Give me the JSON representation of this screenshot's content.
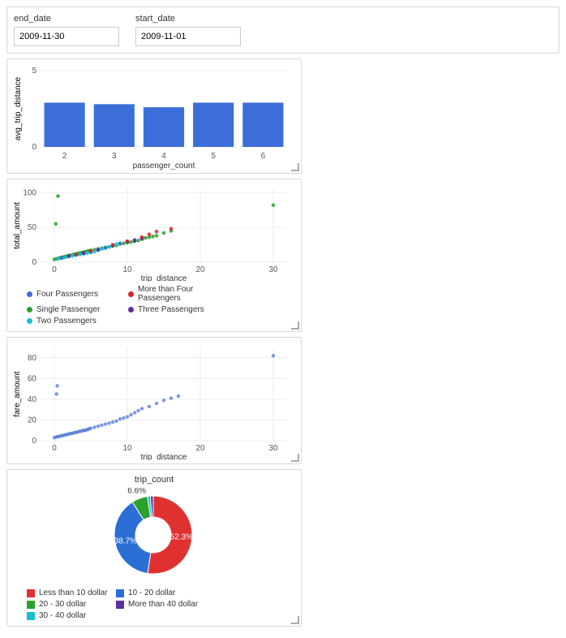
{
  "filters": {
    "end_date": {
      "label": "end_date",
      "value": "2009-11-30"
    },
    "start_date": {
      "label": "start_date",
      "value": "2009-11-01"
    }
  },
  "colors": {
    "bar": "#3b6ed8",
    "four": "#3b6ed8",
    "more_than_four": "#d62728",
    "single": "#2ca02c",
    "three": "#5b2f9e",
    "two": "#17becf",
    "scatter_single": "#5b7fd6",
    "pie_lt10": "#e03131",
    "pie_10_20": "#2b6fd6",
    "pie_20_30": "#2ca02c",
    "pie_gt40": "#5b2f9e",
    "pie_30_40": "#17becf"
  },
  "chart_data": [
    {
      "id": "bar",
      "type": "bar",
      "xlabel": "passenger_count",
      "ylabel": "avg_trip_distance",
      "x_ticks": [
        2,
        3,
        4,
        5,
        6
      ],
      "y_ticks": [
        0,
        5
      ],
      "ylim": [
        0,
        5
      ],
      "categories": [
        2,
        3,
        4,
        5,
        6
      ],
      "values": [
        2.9,
        2.8,
        2.6,
        2.9,
        2.9
      ]
    },
    {
      "id": "scatter_multi",
      "type": "scatter",
      "xlabel": "trip_distance",
      "ylabel": "total_amount",
      "x_ticks": [
        0,
        10,
        20,
        30
      ],
      "y_ticks": [
        0,
        50,
        100
      ],
      "xlim": [
        -2,
        32
      ],
      "ylim": [
        0,
        105
      ],
      "legend": [
        {
          "key": "four",
          "label": "Four Passengers"
        },
        {
          "key": "more_than_four",
          "label": "More than Four Passengers"
        },
        {
          "key": "single",
          "label": "Single Passenger"
        },
        {
          "key": "three",
          "label": "Three Passengers"
        },
        {
          "key": "two",
          "label": "Two Passengers"
        }
      ],
      "series": [
        {
          "name": "single",
          "points": [
            [
              0,
              4
            ],
            [
              0.3,
              5
            ],
            [
              0.5,
              5
            ],
            [
              0.7,
              6
            ],
            [
              0.9,
              6
            ],
            [
              1,
              7
            ],
            [
              1.2,
              7
            ],
            [
              1.4,
              8
            ],
            [
              1.6,
              8
            ],
            [
              1.8,
              9
            ],
            [
              2,
              9
            ],
            [
              2.2,
              10
            ],
            [
              2.4,
              10
            ],
            [
              2.6,
              11
            ],
            [
              2.8,
              11
            ],
            [
              3,
              12
            ],
            [
              3.2,
              12
            ],
            [
              3.4,
              13
            ],
            [
              3.6,
              13
            ],
            [
              3.8,
              14
            ],
            [
              4,
              14
            ],
            [
              4.2,
              15
            ],
            [
              4.4,
              15
            ],
            [
              4.6,
              16
            ],
            [
              4.8,
              16
            ],
            [
              5,
              17
            ],
            [
              5.5,
              18
            ],
            [
              6,
              19
            ],
            [
              6.5,
              20
            ],
            [
              7,
              21
            ],
            [
              7.5,
              22
            ],
            [
              8,
              23
            ],
            [
              8.5,
              24
            ],
            [
              9,
              26
            ],
            [
              9.5,
              27
            ],
            [
              10,
              28
            ],
            [
              10.5,
              29
            ],
            [
              11,
              30
            ],
            [
              11.5,
              31
            ],
            [
              12,
              33
            ],
            [
              12.5,
              35
            ],
            [
              13,
              36
            ],
            [
              13.5,
              37
            ],
            [
              14,
              38
            ],
            [
              15,
              42
            ],
            [
              16,
              45
            ],
            [
              0.2,
              55
            ],
            [
              0.5,
              95
            ],
            [
              30,
              82
            ]
          ]
        },
        {
          "name": "two",
          "points": [
            [
              0.5,
              5
            ],
            [
              1,
              6
            ],
            [
              1.5,
              7
            ],
            [
              2,
              8
            ],
            [
              2.5,
              9
            ],
            [
              3,
              10
            ],
            [
              3.5,
              11
            ],
            [
              4,
              12
            ],
            [
              4.5,
              13
            ],
            [
              5,
              14
            ],
            [
              5.5,
              15
            ],
            [
              6,
              17
            ],
            [
              6.5,
              19
            ],
            [
              7,
              20
            ],
            [
              7.5,
              22
            ],
            [
              8,
              24
            ],
            [
              8.5,
              26
            ],
            [
              9,
              27
            ],
            [
              10,
              29
            ]
          ]
        },
        {
          "name": "four",
          "points": [
            [
              1,
              6
            ],
            [
              2,
              9
            ],
            [
              3,
              11
            ],
            [
              4,
              13
            ],
            [
              5,
              15
            ],
            [
              6,
              18
            ],
            [
              7,
              21
            ],
            [
              8,
              24
            ],
            [
              9,
              27
            ],
            [
              10,
              30
            ],
            [
              11,
              32
            ],
            [
              12,
              34
            ]
          ]
        },
        {
          "name": "three",
          "points": [
            [
              2,
              9
            ],
            [
              4,
              13
            ],
            [
              6,
              18
            ],
            [
              8,
              24
            ],
            [
              10,
              29
            ],
            [
              11,
              31
            ],
            [
              12,
              34
            ]
          ]
        },
        {
          "name": "more_than_four",
          "points": [
            [
              3,
              11
            ],
            [
              5,
              16
            ],
            [
              8,
              25
            ],
            [
              10,
              30
            ],
            [
              12,
              36
            ],
            [
              13,
              40
            ],
            [
              14,
              44
            ],
            [
              16,
              48
            ]
          ]
        }
      ]
    },
    {
      "id": "scatter_fare",
      "type": "scatter",
      "xlabel": "trip_distance",
      "ylabel": "fare_amount",
      "x_ticks": [
        0,
        10,
        20,
        30
      ],
      "y_ticks": [
        0,
        20,
        40,
        60,
        80
      ],
      "xlim": [
        -2,
        32
      ],
      "ylim": [
        0,
        90
      ],
      "points": [
        [
          0,
          3
        ],
        [
          0.2,
          3.5
        ],
        [
          0.4,
          4
        ],
        [
          0.6,
          4
        ],
        [
          0.8,
          4.5
        ],
        [
          1,
          5
        ],
        [
          1.2,
          5
        ],
        [
          1.4,
          5.5
        ],
        [
          1.6,
          6
        ],
        [
          1.8,
          6
        ],
        [
          2,
          6.5
        ],
        [
          2.2,
          7
        ],
        [
          2.4,
          7
        ],
        [
          2.6,
          7.5
        ],
        [
          2.8,
          8
        ],
        [
          3,
          8
        ],
        [
          3.2,
          8.5
        ],
        [
          3.4,
          9
        ],
        [
          3.6,
          9
        ],
        [
          3.8,
          9.5
        ],
        [
          4,
          10
        ],
        [
          4.2,
          10
        ],
        [
          4.4,
          10.5
        ],
        [
          4.6,
          11
        ],
        [
          4.8,
          11.5
        ],
        [
          5,
          12
        ],
        [
          5.5,
          13
        ],
        [
          6,
          14
        ],
        [
          6.5,
          15
        ],
        [
          7,
          16
        ],
        [
          7.5,
          17
        ],
        [
          8,
          18
        ],
        [
          8.5,
          19
        ],
        [
          9,
          21
        ],
        [
          9.5,
          22
        ],
        [
          10,
          23
        ],
        [
          10.5,
          25
        ],
        [
          11,
          27
        ],
        [
          11.5,
          29
        ],
        [
          12,
          31
        ],
        [
          13,
          33
        ],
        [
          14,
          36
        ],
        [
          15,
          39
        ],
        [
          16,
          41
        ],
        [
          17,
          43
        ],
        [
          0.3,
          45
        ],
        [
          0.4,
          53
        ],
        [
          30,
          82
        ]
      ]
    },
    {
      "id": "donut",
      "type": "pie",
      "title": "trip_count",
      "slices": [
        {
          "key": "pie_lt10",
          "label": "Less than 10 dollar",
          "value": 52.3,
          "show_label": "52.3%"
        },
        {
          "key": "pie_10_20",
          "label": "10 - 20 dollar",
          "value": 38.7,
          "show_label": "38.7%"
        },
        {
          "key": "pie_20_30",
          "label": "20 - 30 dollar",
          "value": 6.6,
          "show_label": "6.6%"
        },
        {
          "key": "pie_30_40",
          "label": "30 - 40 dollar",
          "value": 1.2
        },
        {
          "key": "pie_gt40",
          "label": "More than 40 dollar",
          "value": 1.2
        }
      ],
      "legend": [
        {
          "key": "pie_lt10",
          "label": "Less than 10 dollar"
        },
        {
          "key": "pie_10_20",
          "label": "10 - 20 dollar"
        },
        {
          "key": "pie_20_30",
          "label": "20 - 30 dollar"
        },
        {
          "key": "pie_gt40",
          "label": "More than 40 dollar"
        },
        {
          "key": "pie_30_40",
          "label": "30 - 40 dollar"
        }
      ]
    }
  ]
}
